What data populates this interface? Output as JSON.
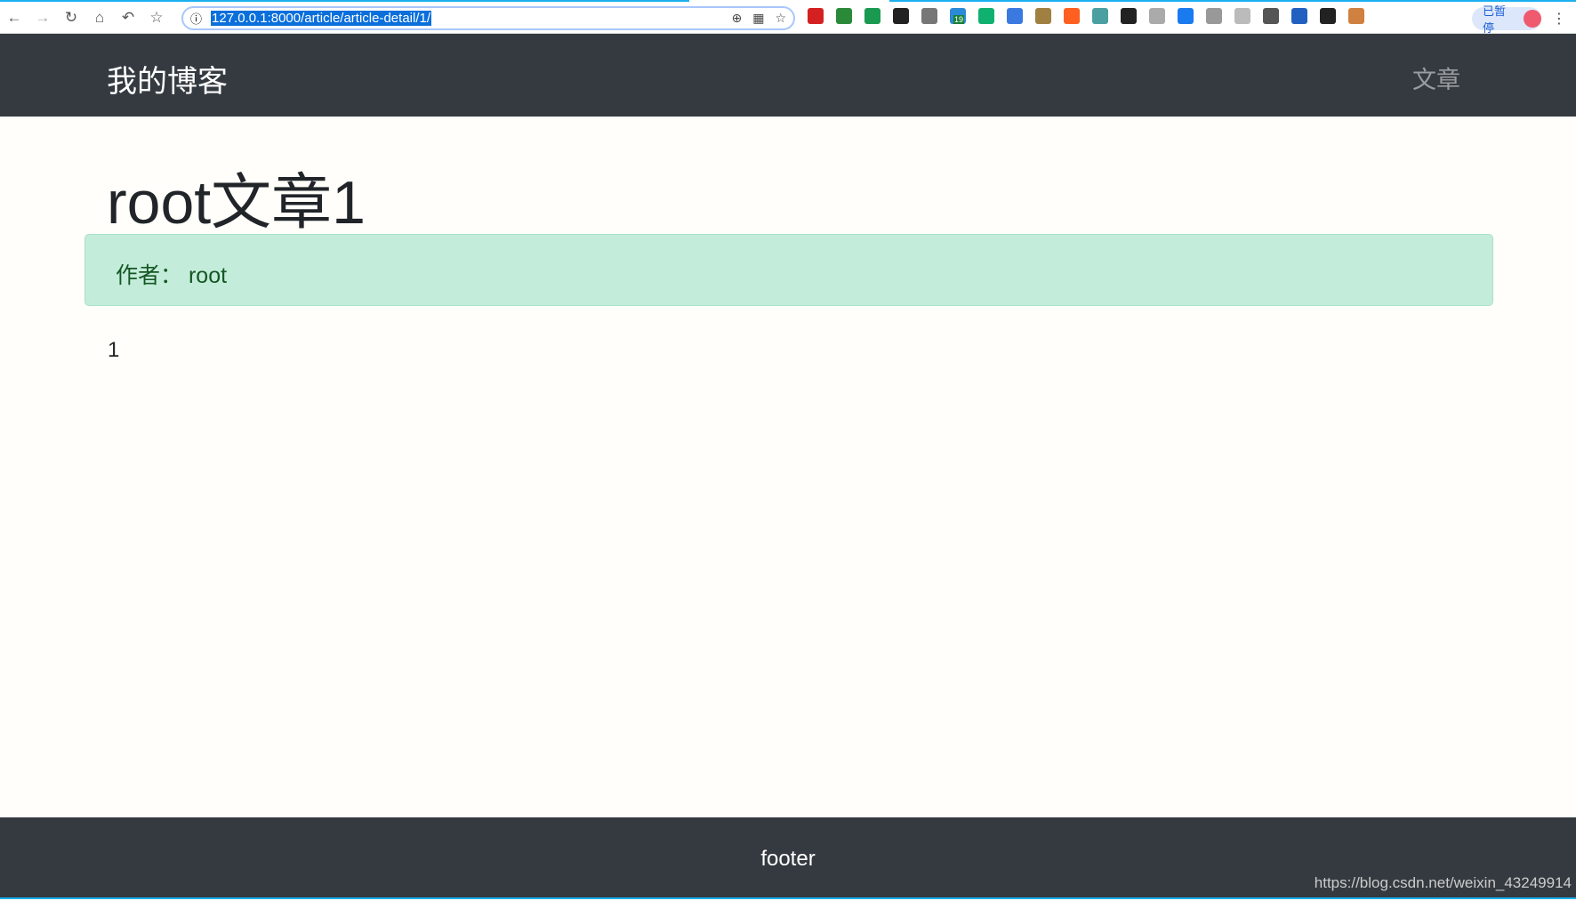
{
  "browser": {
    "url": "127.0.0.1:8000/article/article-detail/1/",
    "extension_badge": "19",
    "profile_status": "已暂停",
    "icons": [
      "back-icon",
      "forward-icon",
      "reload-icon",
      "home-icon",
      "undo-icon",
      "bookmark-star-icon",
      "info-icon",
      "zoom-icon",
      "qr-code-icon",
      "star-icon"
    ],
    "extension_colors": [
      "#d42020",
      "#2a8a3a",
      "#1a9a50",
      "#222222",
      "#777777",
      "#2a8ad8",
      "#10b070",
      "#3a7ae0",
      "#a08040",
      "#ff6020",
      "#4aa0a0",
      "#222222",
      "#aaaaaa",
      "#1a7af0",
      "#999999",
      "#bbbbbb",
      "#555555",
      "#2060c0",
      "#222222",
      "#d08040"
    ]
  },
  "navbar": {
    "brand": "我的博客",
    "link": "文章"
  },
  "article": {
    "title": "root文章1",
    "author_label": "作者：",
    "author": "root",
    "body": "1"
  },
  "footer": {
    "text": "footer"
  },
  "watermark": "https://blog.csdn.net/weixin_43249914",
  "colors": {
    "navbar": "#343a40",
    "alert_bg": "#c3ecda",
    "alert_text": "#155724"
  }
}
